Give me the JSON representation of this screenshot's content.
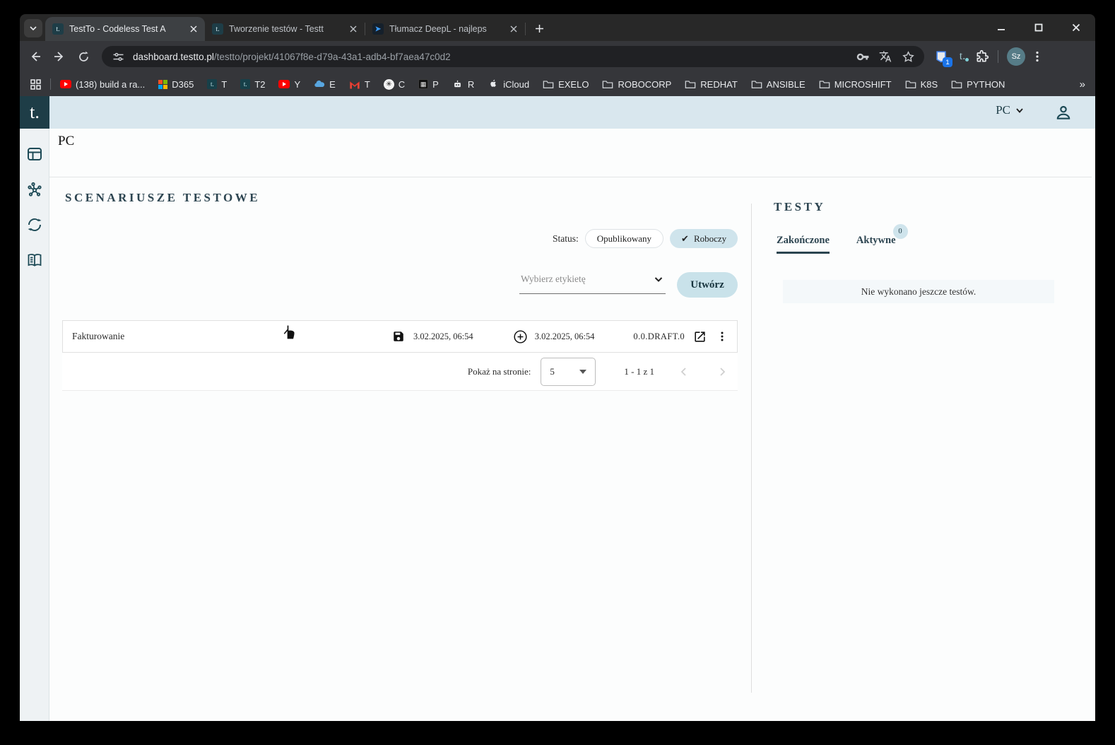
{
  "theme": {
    "teal_dark": "#1e3d47",
    "header_band": "#d9e7ee",
    "sidebar_bg": "#eef2f4",
    "accent_fill": "#cfe4ec",
    "heading_color": "#2d4551"
  },
  "browser": {
    "favicon_text": "t.",
    "tabs": [
      {
        "title": "TestTo - Codeless Test A"
      },
      {
        "title": "Tworzenie testów - Testt"
      },
      {
        "title": "Tłumacz DeepL - najleps"
      }
    ],
    "url": {
      "host": "dashboard.testto.pl",
      "path": "/testto/projekt/41067f8e-d79a-43a1-adb4-bf7aea47c0d2"
    },
    "toolbar": {
      "extension_badge": "1",
      "avatar_initials": "Sz"
    },
    "bookmarks": [
      {
        "label": "(138) build a ra..."
      },
      {
        "label": "D365"
      },
      {
        "label": "T"
      },
      {
        "label": "T2"
      },
      {
        "label": "Y"
      },
      {
        "label": "E"
      },
      {
        "label": "T"
      },
      {
        "label": "C"
      },
      {
        "label": "P"
      },
      {
        "label": "R"
      },
      {
        "label": "iCloud"
      },
      {
        "label": "EXELO"
      },
      {
        "label": "ROBOCORP"
      },
      {
        "label": "REDHAT"
      },
      {
        "label": "ANSIBLE"
      },
      {
        "label": "MICROSHIFT"
      },
      {
        "label": "K8S"
      },
      {
        "label": "PYTHON"
      }
    ]
  },
  "app": {
    "logo_text": "t.",
    "header": {
      "project_label": "PC"
    },
    "page_title": "PC",
    "scenarios": {
      "title": "SCENARIUSZE TESTOWE",
      "status_label": "Status:",
      "filters": [
        {
          "label": "Opublikowany"
        },
        {
          "label": "Roboczy",
          "check": "✔"
        }
      ],
      "label_select_placeholder": "Wybierz etykietę",
      "create_button": "Utwórz",
      "rows": [
        {
          "name": "Fakturowanie",
          "saved_at": "3.02.2025, 06:54",
          "created_at": "3.02.2025, 06:54",
          "version": "0.0.DRAFT.0"
        }
      ],
      "pagination": {
        "per_page_label": "Pokaż na stronie:",
        "per_page": "5",
        "range": "1 - 1 z 1"
      }
    },
    "tests": {
      "title": "TESTY",
      "tabs": [
        {
          "label": "Zakończone"
        },
        {
          "label": "Aktywne",
          "badge": "0"
        }
      ],
      "empty_message": "Nie wykonano jeszcze testów."
    }
  }
}
